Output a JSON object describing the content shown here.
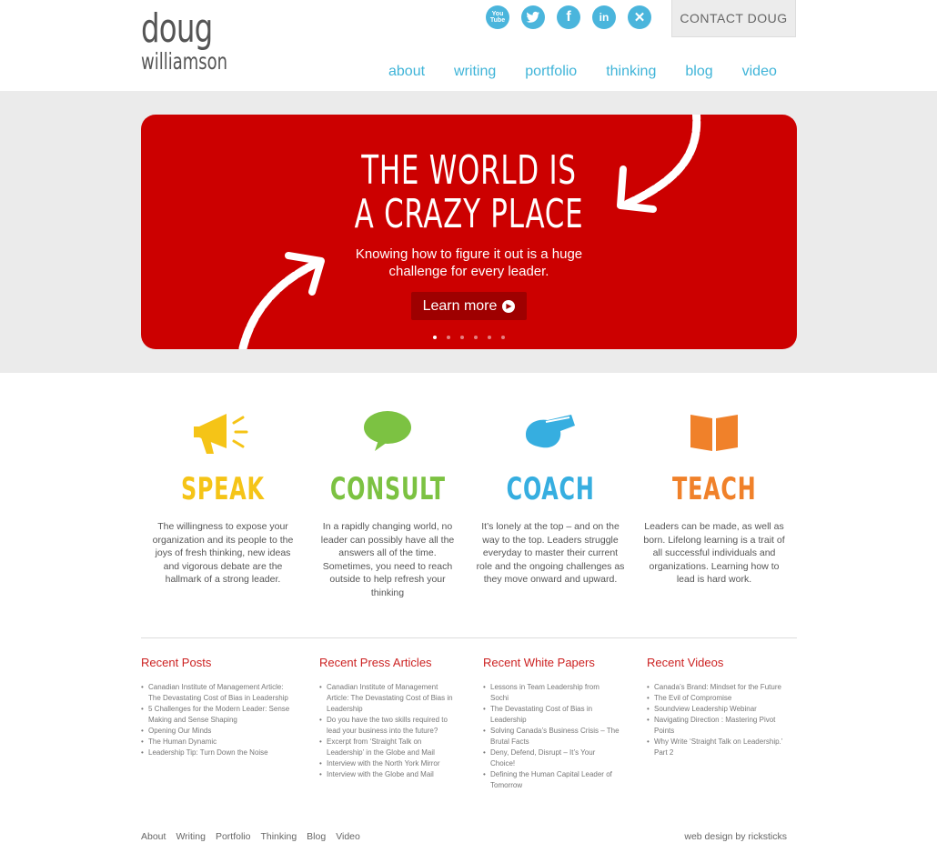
{
  "header": {
    "logo_line1": "doug",
    "logo_line2": "williamson",
    "social": [
      {
        "name": "youtube-icon",
        "glyph": "You\nTube"
      },
      {
        "name": "twitter-icon",
        "glyph": "t"
      },
      {
        "name": "facebook-icon",
        "glyph": "f"
      },
      {
        "name": "linkedin-icon",
        "glyph": "in"
      },
      {
        "name": "xing-icon",
        "glyph": "✕"
      }
    ],
    "contact_label": "CONTACT DOUG",
    "nav": [
      "about",
      "writing",
      "portfolio",
      "thinking",
      "blog",
      "video"
    ]
  },
  "hero": {
    "headline_line1": "THE WORLD IS",
    "headline_line2": "A CRAZY PLACE",
    "subtext_line1": "Knowing how to figure it out is a huge",
    "subtext_line2": "challenge for every leader.",
    "cta": "Learn more",
    "slides": 6,
    "active_slide": 1,
    "bg_color": "#cc0000"
  },
  "services": [
    {
      "title": "SPEAK",
      "color": "#f5c417",
      "icon": "megaphone-icon",
      "desc": "The willingness to expose your organization and its people to the joys of fresh thinking, new ideas and vigorous debate are the hallmark of a strong leader."
    },
    {
      "title": "CONSULT",
      "color": "#7cc242",
      "icon": "speech-bubble-icon",
      "desc": "In a rapidly changing world, no leader can possibly have all the answers all of the time. Sometimes, you need to reach outside to help refresh your thinking"
    },
    {
      "title": "COACH",
      "color": "#36aee0",
      "icon": "whistle-icon",
      "desc": "It’s lonely at the top – and on the way to the top. Leaders struggle everyday to master their current role and the ongoing challenges as they move onward and upward."
    },
    {
      "title": "TEACH",
      "color": "#f0812a",
      "icon": "book-icon",
      "desc": "Leaders can be made, as well as born. Lifelong learning is a trait of all successful individuals and organizations. Learning how to lead is hard work."
    }
  ],
  "lists": [
    {
      "title": "Recent Posts",
      "items": [
        "Canadian Institute of Management Article: The Devastating Cost of Bias in Leadership",
        "5 Challenges for the Modern Leader: Sense Making and Sense Shaping",
        "Opening Our Minds",
        "The Human Dynamic",
        "Leadership Tip: Turn Down the Noise"
      ]
    },
    {
      "title": "Recent Press Articles",
      "items": [
        "Canadian Institute of Management Article: The Devastating Cost of Bias in Leadership",
        "Do you have the two skills required to lead your business into the future?",
        "Excerpt from ‘Straight Talk on Leadership’ in the Globe and Mail",
        "Interview with the North York Mirror",
        "Interview with the Globe and Mail"
      ]
    },
    {
      "title": "Recent White Papers",
      "items": [
        "Lessons in Team Leadership from Sochi",
        "The Devastating Cost of Bias in Leadership",
        "Solving Canada’s Business Crisis – The Brutal Facts",
        "Deny, Defend, Disrupt – It’s Your Choice!",
        "Defining the Human Capital Leader of Tomorrow"
      ]
    },
    {
      "title": "Recent Videos",
      "items": [
        "Canada’s Brand: Mindset for the Future",
        "The Evil of Compromise",
        "Soundview Leadership Webinar",
        "Navigating Direction : Mastering Pivot Points",
        "Why Write ‘Straight Talk on Leadership.’ Part 2"
      ]
    }
  ],
  "footer": {
    "links": [
      "About",
      "Writing",
      "Portfolio",
      "Thinking",
      "Blog",
      "Video"
    ],
    "credit": "web design by ricksticks"
  }
}
